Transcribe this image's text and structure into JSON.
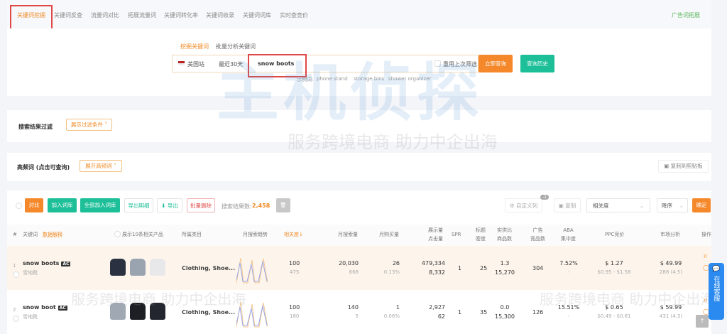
{
  "nav": {
    "tabs": [
      "关键词挖掘",
      "关键词反查",
      "流量词对比",
      "拓展流量词",
      "关键词转化率",
      "关键词收录",
      "关键词词库",
      "实时查竞价"
    ],
    "right_link": "广告词拓展"
  },
  "search": {
    "mode_tabs": [
      "挖掘关键词",
      "批量分析关键词"
    ],
    "site": "美国站",
    "period": "最近30天",
    "keyword": "snow boots",
    "reuse_label": "重用上次筛选",
    "query_button": "立即查询",
    "history_button": "查询历史",
    "examples_label": "示例词:",
    "examples": [
      "phone stand",
      "storage bins",
      "shower organizer"
    ]
  },
  "filter": {
    "title": "搜索结果过滤",
    "toggle": "展示过滤条件"
  },
  "hot": {
    "title": "高频词 (点击可查询)",
    "toggle": "展开高频词",
    "copy": "复制到剪贴板"
  },
  "toolbar": {
    "compare": "对比",
    "add_lib": "加入词库",
    "add_all": "全部加入词库",
    "export_detail": "导出明细",
    "export": "导出",
    "batch_delete": "批量删除",
    "result_label": "搜索结果数:",
    "result_count": "2,458",
    "custom_cols": "自定义列",
    "custom_badge": "-1",
    "copy": "复制",
    "sort_field": "相关度",
    "sort_order": "降序",
    "confirm": "确定"
  },
  "table": {
    "headers": {
      "idx": "#",
      "keyword": "关键词",
      "explain": "数据解释",
      "show10": "展示10条相关产品",
      "category": "所属类目",
      "trend": "月搜索趋势",
      "relevance": "相关度",
      "monthly_search": "月搜索量",
      "monthly_buy": "月购买量",
      "impr": "展示量",
      "clicks": "点击量",
      "spr": "SPR",
      "title1": "标题",
      "title2": "密度",
      "supply1": "实供比",
      "supply2": "商品数",
      "ad1": "广告",
      "ad2": "竞品数",
      "aba1": "ABA",
      "aba2": "集中度",
      "ppc": "PPC竞价",
      "market": "市场分析",
      "ops": "操作"
    },
    "rows": [
      {
        "idx": "1",
        "keyword": "snow boots",
        "badge": "AC",
        "cn": "雪地靴",
        "category": "Clothing, Shoe...",
        "relevance": "100",
        "relevance_sub": "475",
        "search": "20,030",
        "search_sub": "668",
        "buy": "26",
        "buy_sub": "0.13%",
        "impr": "479,334",
        "clicks": "8,332",
        "spr": "1",
        "title": "25",
        "supply": "1.3",
        "supply_sub": "15,270",
        "ad": "304",
        "aba": "7.52%",
        "aba_sub": "-",
        "ppc": "$ 1.27",
        "ppc_range": "$0.95 - $1.58",
        "price": "$ 49.99",
        "price_sub": "288 (4.5)"
      },
      {
        "idx": "2",
        "keyword": "snow boot",
        "badge": "AC",
        "cn": "雪地靴",
        "category": "Clothing, Shoe...",
        "relevance": "100",
        "relevance_sub": "180",
        "search": "140",
        "search_sub": "5",
        "buy": "1",
        "buy_sub": "0.06%",
        "impr": "2,927",
        "clicks": "62",
        "spr": "1",
        "title": "35",
        "supply": "0.0",
        "supply_sub": "15,300",
        "ad": "126",
        "aba": "15.51%",
        "aba_sub": "-",
        "ppc": "$ 0.65",
        "ppc_range": "$0.49 - $0.81",
        "price": "$ 59.99",
        "price_sub": "431 (4.3)"
      }
    ]
  },
  "chat": {
    "label": "在线客服"
  },
  "watermark": {
    "brand": "主机侦探",
    "slogan": "服务跨境电商 助力中企出海"
  },
  "colors": {
    "accent": "#f5882a",
    "green": "#1cbf98"
  }
}
